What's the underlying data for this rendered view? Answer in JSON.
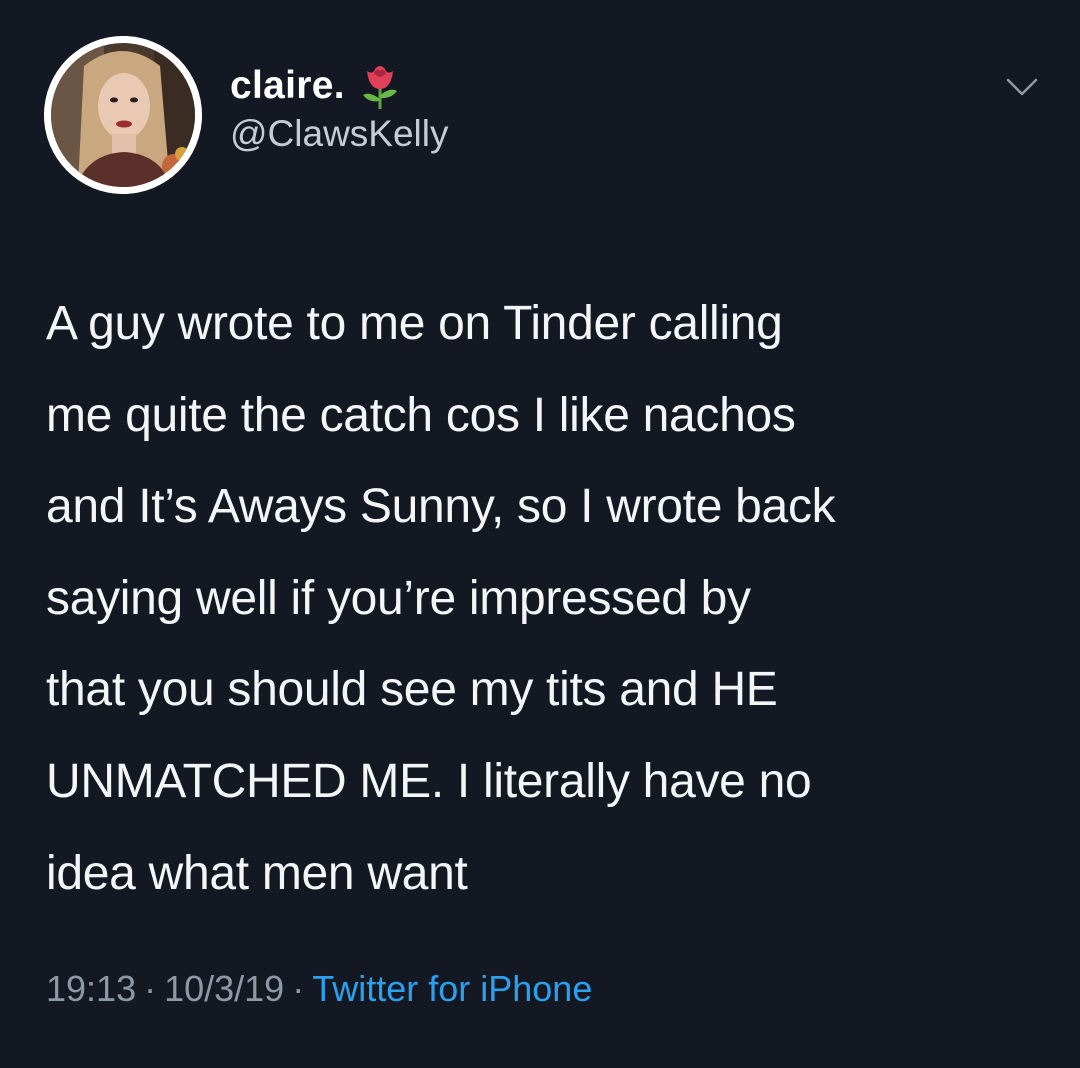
{
  "tweet": {
    "display_name": "claire.",
    "handle": "@ClawsKelly",
    "name_emoji_icon": "rose-icon",
    "menu_icon": "chevron-down-icon",
    "avatar_icon": "profile-photo",
    "body_lines": [
      "A guy wrote to me on Tinder calling",
      "me quite the catch cos I like nachos",
      "and It’s Aways Sunny, so I wrote back",
      "saying well if you’re impressed by",
      "that you should see my tits and HE",
      "UNMATCHED ME. I literally have no",
      "idea what men want"
    ],
    "time": "19:13",
    "date": "10/3/19",
    "separator": "·",
    "source": "Twitter for iPhone"
  },
  "colors": {
    "background": "#131822",
    "text": "#f3f5f7",
    "secondary_text": "#8e99a6",
    "link": "#2aa0ef"
  }
}
